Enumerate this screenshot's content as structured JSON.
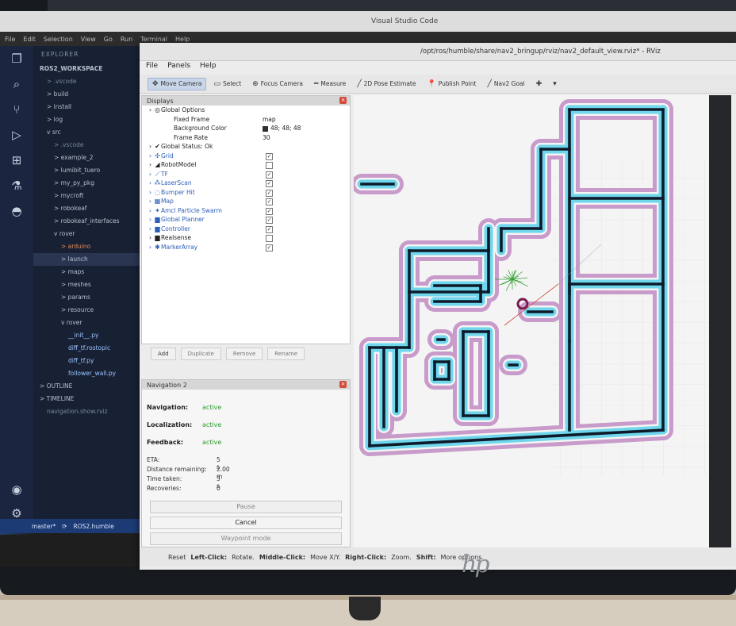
{
  "vscode": {
    "title": "Visual Studio Code",
    "menu": [
      "File",
      "Edit",
      "Selection",
      "View",
      "Go",
      "Run",
      "Terminal",
      "Help"
    ],
    "explorer_title": "EXPLORER",
    "tree": [
      {
        "label": "ROS2_WORKSPACE",
        "indent": 0,
        "style": "bold"
      },
      {
        "label": "> .vscode",
        "indent": 1,
        "style": "dim"
      },
      {
        "label": "> build",
        "indent": 1
      },
      {
        "label": "> install",
        "indent": 1
      },
      {
        "label": "> log",
        "indent": 1
      },
      {
        "label": "v src",
        "indent": 1
      },
      {
        "label": "> .vscode",
        "indent": 2,
        "style": "dim"
      },
      {
        "label": "> example_2",
        "indent": 2
      },
      {
        "label": "> lumibit_tuero",
        "indent": 2
      },
      {
        "label": "> my_py_pkg",
        "indent": 2
      },
      {
        "label": "> mycroft",
        "indent": 2
      },
      {
        "label": "> robokeaf",
        "indent": 2
      },
      {
        "label": "> robokeaf_interfaces",
        "indent": 2
      },
      {
        "label": "v rover",
        "indent": 2
      },
      {
        "label": "> arduino",
        "indent": 3,
        "style": "orange"
      },
      {
        "label": "> launch",
        "indent": 3,
        "style": "active"
      },
      {
        "label": "> maps",
        "indent": 3
      },
      {
        "label": "> meshes",
        "indent": 3
      },
      {
        "label": "> params",
        "indent": 3
      },
      {
        "label": "> resource",
        "indent": 3
      },
      {
        "label": "v rover",
        "indent": 3
      },
      {
        "label": "__init__.py",
        "indent": 4,
        "style": "blue"
      },
      {
        "label": "diff_tf.rostopic",
        "indent": 4,
        "style": "blue"
      },
      {
        "label": "diff_tf.py",
        "indent": 4,
        "style": "blue"
      },
      {
        "label": "follower_wall.py",
        "indent": 4,
        "style": "blue"
      },
      {
        "label": "> OUTLINE",
        "indent": 0
      },
      {
        "label": "> TIMELINE",
        "indent": 0
      },
      {
        "label": "navigation.show.rviz",
        "indent": 1,
        "style": "dim"
      }
    ],
    "status_branch": "master*",
    "status_distro": "ROS2.humble"
  },
  "rviz": {
    "title": "/opt/ros/humble/share/nav2_bringup/rviz/nav2_default_view.rviz* - RViz",
    "menu": [
      "File",
      "Panels",
      "Help"
    ],
    "tools": [
      {
        "label": "Move Camera",
        "icon": "✥",
        "active": true
      },
      {
        "label": "Select",
        "icon": "▭",
        "active": false
      },
      {
        "label": "Focus Camera",
        "icon": "⊕",
        "active": false
      },
      {
        "label": "Measure",
        "icon": "═",
        "active": false
      },
      {
        "label": "2D Pose Estimate",
        "icon": "╱",
        "active": false
      },
      {
        "label": "Publish Point",
        "icon": "📍",
        "active": false
      },
      {
        "label": "Nav2 Goal",
        "icon": "╱",
        "active": false
      },
      {
        "label": "",
        "icon": "✚",
        "active": false
      },
      {
        "label": "",
        "icon": "▾",
        "active": false
      }
    ],
    "displays": {
      "title": "Displays",
      "rows": [
        {
          "label": "Global Options",
          "indent": 0,
          "icon": "◎",
          "value": ""
        },
        {
          "label": "Fixed Frame",
          "indent": 2,
          "icon": "",
          "value": "map"
        },
        {
          "label": "Background Color",
          "indent": 2,
          "icon": "",
          "value": "48; 48; 48",
          "swatch": true
        },
        {
          "label": "Frame Rate",
          "indent": 2,
          "icon": "",
          "value": "30"
        },
        {
          "label": "Global Status: Ok",
          "indent": 0,
          "icon": "✔",
          "value": ""
        },
        {
          "label": "Grid",
          "indent": 0,
          "icon": "✣",
          "check": true,
          "blue": true
        },
        {
          "label": "RobotModel",
          "indent": 0,
          "icon": "◢",
          "check": false
        },
        {
          "label": "TF",
          "indent": 0,
          "icon": "⟋",
          "check": true,
          "blue": true
        },
        {
          "label": "LaserScan",
          "indent": 0,
          "icon": "⁂",
          "check": true,
          "blue": true
        },
        {
          "label": "Bumper Hit",
          "indent": 0,
          "icon": "◌",
          "check": true,
          "blue": true
        },
        {
          "label": "Map",
          "indent": 0,
          "icon": "▦",
          "check": true,
          "blue": true
        },
        {
          "label": "Amcl Particle Swarm",
          "indent": 0,
          "icon": "✦",
          "check": true,
          "blue": true
        },
        {
          "label": "Global Planner",
          "indent": 0,
          "icon": "▆",
          "check": true,
          "blue": true
        },
        {
          "label": "Controller",
          "indent": 0,
          "icon": "▆",
          "check": true,
          "blue": true
        },
        {
          "label": "Realsense",
          "indent": 0,
          "icon": "▆",
          "check": false
        },
        {
          "label": "MarkerArray",
          "indent": 0,
          "icon": "✱",
          "check": true,
          "blue": true
        }
      ],
      "buttons": [
        {
          "label": "Add",
          "enabled": true
        },
        {
          "label": "Duplicate",
          "enabled": false
        },
        {
          "label": "Remove",
          "enabled": false
        },
        {
          "label": "Rename",
          "enabled": false
        }
      ]
    },
    "navigation": {
      "title": "Navigation 2",
      "navigation_label": "Navigation:",
      "navigation_value": "active",
      "localization_label": "Localization:",
      "localization_value": "active",
      "feedback_label": "Feedback:",
      "feedback_value": "active",
      "eta_label": "ETA:",
      "eta_value": "5 s",
      "distance_label": "Distance remaining:",
      "distance_value": "2.00 m",
      "time_label": "Time taken:",
      "time_value": "3 s",
      "recoveries_label": "Recoveries:",
      "recoveries_value": "0",
      "pause_label": "Pause",
      "cancel_label": "Cancel",
      "waypoint_label": "Waypoint mode"
    },
    "status": {
      "reset_label": "Reset",
      "hint_left_click": "Left-Click:",
      "hint_left_text": "Rotate.",
      "hint_middle_click": "Middle-Click:",
      "hint_middle_text": "Move X/Y.",
      "hint_right_click": "Right-Click:",
      "hint_right_text": "Zoom.",
      "hint_shift": "Shift:",
      "hint_shift_text": "More options."
    }
  },
  "colors": {
    "wall": "#0d1a2a",
    "inflation_inner": "#6fd6ec",
    "inflation_outer": "#c89bcb",
    "robot_path": "#2f9e2f",
    "rviz_link_blue": "#2c5fb8",
    "nav_active_green": "#2c9a2c",
    "vscode_sidebar": "#182033"
  },
  "monitor_brand": "hp"
}
